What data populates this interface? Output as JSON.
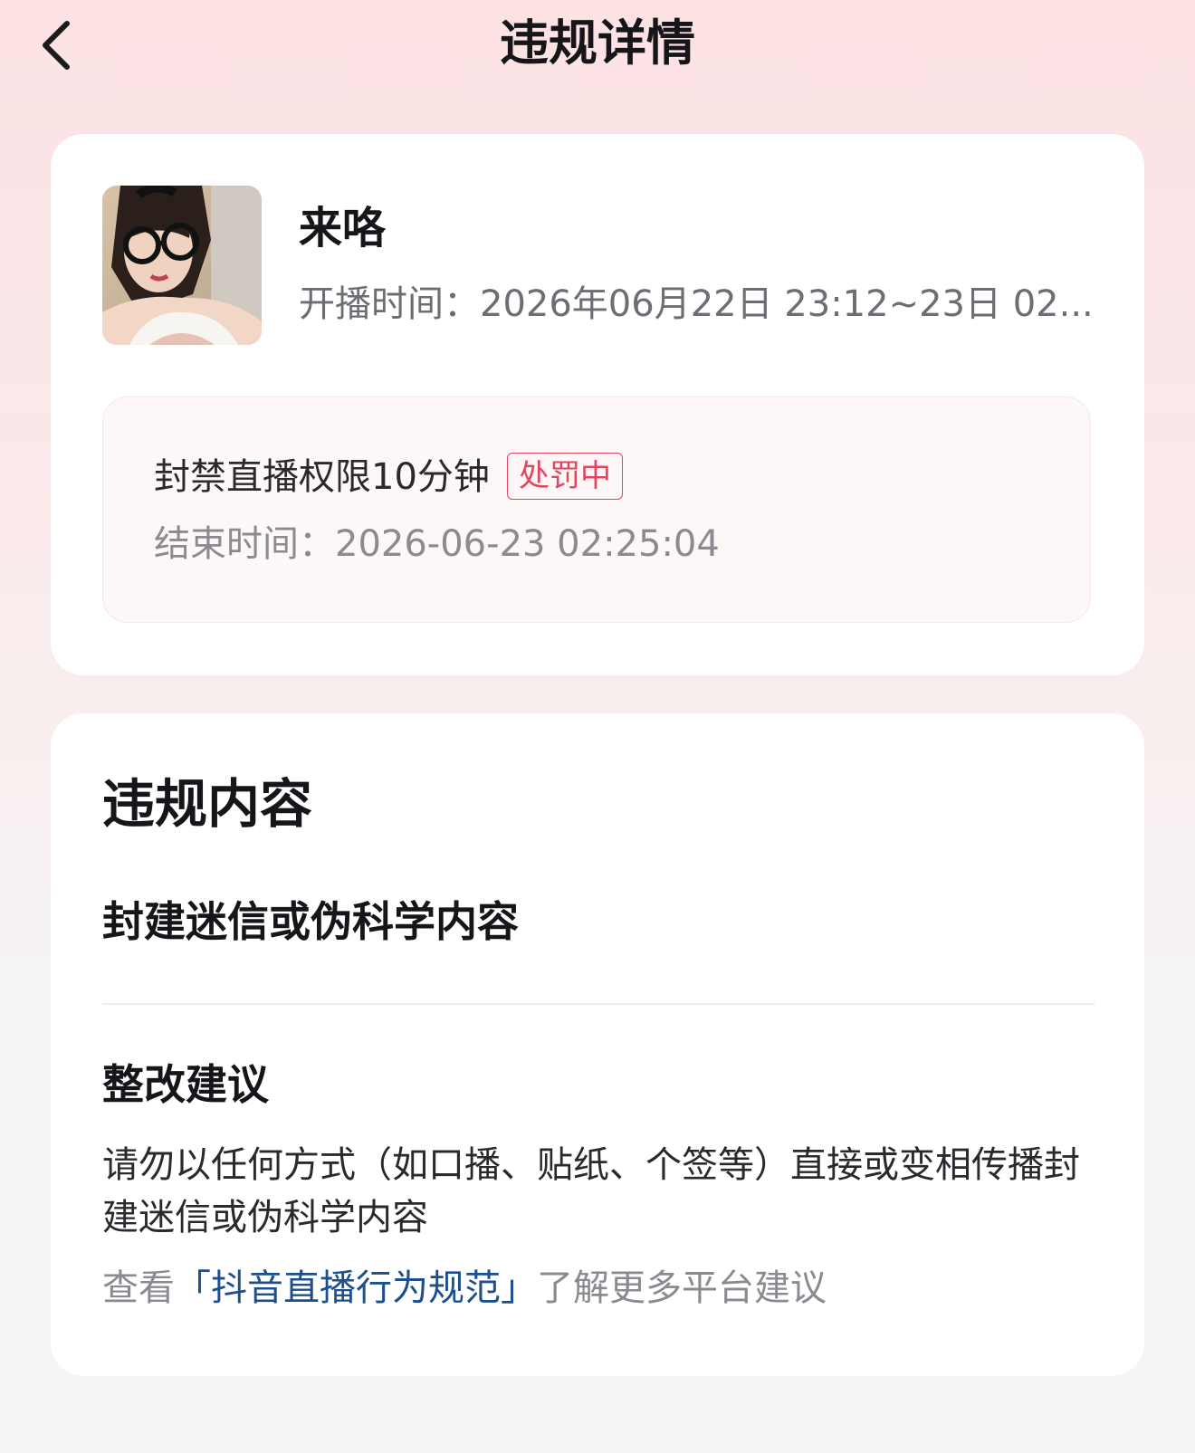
{
  "header": {
    "title": "违规详情",
    "back_icon": "chevron-left-icon"
  },
  "stream": {
    "name": "来咯",
    "time_label": "开播时间：",
    "time_value": "2026年06月22日 23:12~23日 02..."
  },
  "penalty": {
    "title": "封禁直播权限10分钟",
    "status_badge": "处罚中",
    "end_time_label": "结束时间：",
    "end_time_value": "2026-06-23 02:25:04"
  },
  "violation": {
    "heading": "违规内容",
    "type": "封建迷信或伪科学内容"
  },
  "advice": {
    "heading": "整改建议",
    "text": "请勿以任何方式（如口播、贴纸、个签等）直接或变相传播封建迷信或伪科学内容",
    "prefix": "查看",
    "link": "「抖音直播行为规范」",
    "suffix": "了解更多平台建议"
  },
  "colors": {
    "accent_red": "#e2455d",
    "link_blue": "#1d4f8f"
  }
}
